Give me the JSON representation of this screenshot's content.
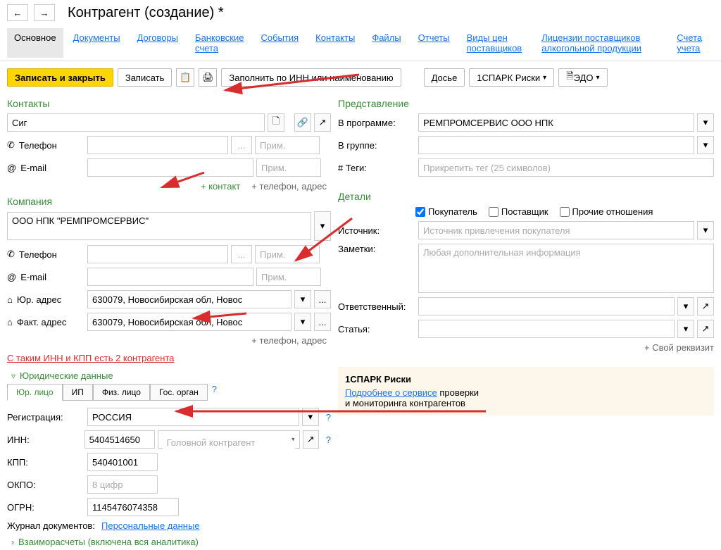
{
  "title": "Контрагент (создание) *",
  "tabs": {
    "main": "Основное",
    "documents": "Документы",
    "contracts": "Договоры",
    "accounts": "Банковские счета",
    "events": "События",
    "contacts": "Контакты",
    "files": "Файлы",
    "reports": "Отчеты",
    "price_types": "Виды цен поставщиков",
    "licenses": "Лицензии поставщиков алкогольной продукции",
    "ledger": "Счета учета"
  },
  "toolbar": {
    "save_close": "Записать и закрыть",
    "save": "Записать",
    "fill_inn": "Заполнить по ИНН или наименованию",
    "dossier": "Досье",
    "spark": "1СПАРК Риски",
    "edo": "ЭДО"
  },
  "contacts": {
    "title": "Контакты",
    "name": "Сиг",
    "phone_label": "Телефон",
    "email_label": "E-mail",
    "note_placeholder": "Прим.",
    "add_contact": "+ контакт",
    "add_phone": "+ телефон, адрес"
  },
  "company": {
    "title": "Компания",
    "name": "ООО НПК \"РЕМПРОМСЕРВИС\"",
    "phone_label": "Телефон",
    "email_label": "E-mail",
    "legal_addr_label": "Юр. адрес",
    "actual_addr_label": "Факт. адрес",
    "legal_addr": "630079, Новосибирская обл, Новос",
    "actual_addr": "630079, Новосибирская обл, Новос",
    "add_phone": "+ телефон, адрес",
    "note_placeholder": "Прим.",
    "ext_placeholder": "..."
  },
  "duplicate_warning": "С таким ИНН и КПП есть 2 контрагента",
  "legal": {
    "title": "Юридические данные",
    "tabs": [
      "Юр. лицо",
      "ИП",
      "Физ. лицо",
      "Гос. орган"
    ],
    "registration_label": "Регистрация:",
    "registration": "РОССИЯ",
    "inn_label": "ИНН:",
    "inn": "5404514650",
    "parent_placeholder": "Головной контрагент",
    "kpp_label": "КПП:",
    "kpp": "540401001",
    "okpo_label": "ОКПО:",
    "okpo_placeholder": "8 цифр",
    "ogrn_label": "ОГРН:",
    "ogrn": "1145476074358",
    "journal_label": "Журнал документов:",
    "journal_link": "Персональные данные"
  },
  "settlements": "Взаиморасчеты (включена вся аналитика)",
  "presentation": {
    "title": "Представление",
    "in_program_label": "В программе:",
    "in_program": "РЕМПРОМСЕРВИС ООО НПК",
    "in_group_label": "В группе:",
    "tags_label": "# Теги:",
    "tags_placeholder": "Прикрепить тег (25 символов)"
  },
  "details": {
    "title": "Детали",
    "buyer": "Покупатель",
    "supplier": "Поставщик",
    "other": "Прочие отношения",
    "source_label": "Источник:",
    "source_placeholder": "Источник привлечения покупателя",
    "notes_label": "Заметки:",
    "notes_placeholder": "Любая дополнительная информация",
    "responsible_label": "Ответственный:",
    "article_label": "Статья:",
    "add_req": "+ Свой реквизит"
  },
  "spark_box": {
    "title": "1СПАРК Риски",
    "link": "Подробнее о сервисе",
    "text1": " проверки",
    "text2": "и мониторинга контрагентов"
  }
}
